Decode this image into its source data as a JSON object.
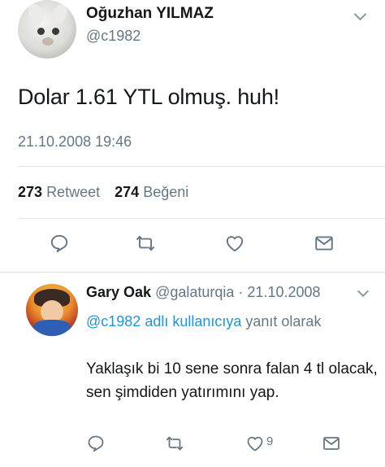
{
  "tweet": {
    "author_name": "Oğuzhan YILMAZ",
    "author_handle": "@c1982",
    "text": "Dolar 1.61 YTL olmuş. huh!",
    "timestamp": "21.10.2008 19:46",
    "retweet_count": "273",
    "retweet_label": "Retweet",
    "like_count": "274",
    "like_label": "Beğeni",
    "actions": [
      "reply-icon",
      "retweet-icon",
      "heart-icon",
      "mail-icon"
    ]
  },
  "reply": {
    "author_name": "Gary Oak",
    "author_handle": "@galaturqia",
    "separator": " · ",
    "date": "21.10.2008",
    "mention": "@c1982 adlı kullanıcıya",
    "replying_suffix": " yanıt olarak",
    "text": "Yaklaşık bi 10 sene sonra falan 4 tl olacak, sen şimdiden yatırımını yap.",
    "like_count": "9",
    "actions": [
      "reply-icon",
      "retweet-icon",
      "heart-icon",
      "mail-icon"
    ]
  },
  "colors": {
    "text": "#14171a",
    "muted": "#657786",
    "link": "#1b95e0",
    "icon": "#657786",
    "divider": "#e1e8ed"
  }
}
